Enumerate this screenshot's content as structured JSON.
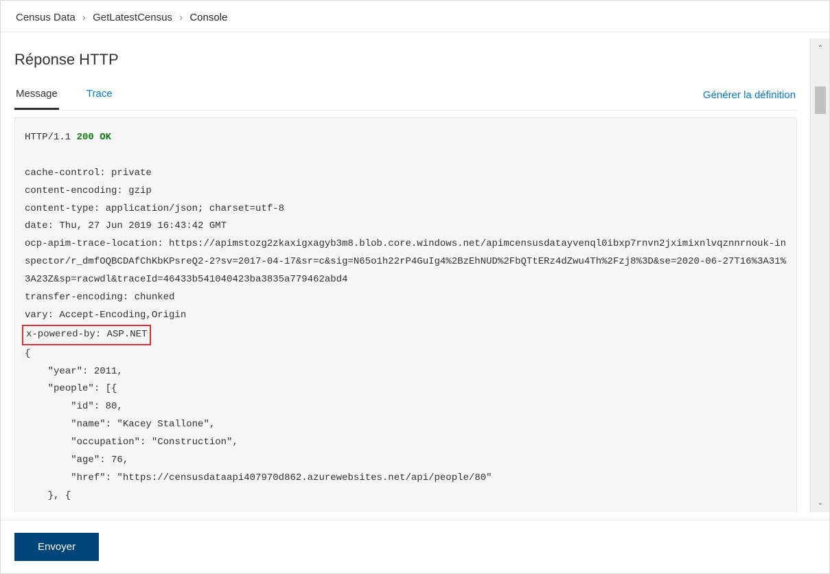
{
  "breadcrumb": {
    "item1": "Census Data",
    "item2": "GetLatestCensus",
    "item3": "Console",
    "sep": "›"
  },
  "page_title": "Réponse HTTP",
  "tabs": {
    "message": "Message",
    "trace": "Trace"
  },
  "generate_link": "Générer la définition",
  "response": {
    "protocol": "HTTP/1.1",
    "status": "200 OK",
    "headers": {
      "cache_control": "cache-control: private",
      "content_encoding": "content-encoding: gzip",
      "content_type": "content-type: application/json; charset=utf-8",
      "date": "date: Thu, 27 Jun 2019 16:43:42 GMT",
      "ocp_apim_trace": "ocp-apim-trace-location: https://apimstozg2zkaxigxagyb3m8.blob.core.windows.net/apimcensusdatayvenql0ibxp7rnvn2jximixnlvqznnrnouk-inspector/r_dmfOQBCDAfChKbKPsreQ2-2?sv=2017-04-17&sr=c&sig=N65o1h22rP4GuIg4%2BzEhNUD%2FbQTtERz4dZwu4Th%2Fzj8%3D&se=2020-06-27T16%3A31%3A23Z&sp=racwdl&traceId=46433b541040423ba3835a779462abd4",
      "transfer_encoding": "transfer-encoding: chunked",
      "vary": "vary: Accept-Encoding,Origin",
      "x_powered_by": "x-powered-by: ASP.NET"
    },
    "body_lines": {
      "l0": "{",
      "l1": "    \"year\": 2011,",
      "l2": "    \"people\": [{",
      "l3": "        \"id\": 80,",
      "l4": "        \"name\": \"Kacey Stallone\",",
      "l5": "        \"occupation\": \"Construction\",",
      "l6": "        \"age\": 76,",
      "l7": "        \"href\": \"https://censusdataapi407970d862.azurewebsites.net/api/people/80\"",
      "l8": "    }, {"
    }
  },
  "footer": {
    "send": "Envoyer"
  },
  "scroll_glyph_up": "⌃",
  "scroll_glyph_down": "⌄"
}
